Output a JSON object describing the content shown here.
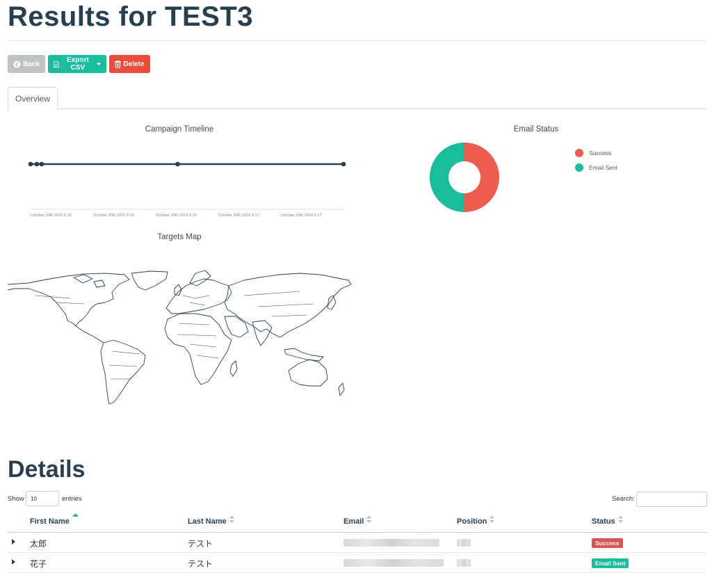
{
  "page": {
    "title": "Results for TEST3"
  },
  "toolbar": {
    "back_label": "Back",
    "export_label": "Export CSV",
    "delete_label": "Delete"
  },
  "tabs": [
    {
      "label": "Overview",
      "active": true
    }
  ],
  "timeline": {
    "title": "Campaign Timeline",
    "tick_labels": [
      "October 30th 2016 6:16",
      "October 30th 2016 6:16",
      "October 30th 2016 6:16",
      "October 30th 2016 6:17",
      "October 30th 2016 6:17"
    ]
  },
  "email_status": {
    "title": "Email Status",
    "legend": [
      {
        "label": "Success",
        "color": "#f05b4f"
      },
      {
        "label": "Email Sent",
        "color": "#1abc9c"
      }
    ]
  },
  "map": {
    "title": "Targets Map"
  },
  "details": {
    "title": "Details",
    "show_label": "Show",
    "length_value": "10",
    "entries_label": "entries",
    "search_label": "Search:",
    "columns": [
      "First Name",
      "Last Name",
      "Email",
      "Position",
      "Status"
    ],
    "rows": [
      {
        "first": "太郎",
        "last": "テスト",
        "status": "Success",
        "status_color": "#d9534f"
      },
      {
        "first": "花子",
        "last": "テスト",
        "status": "Email Sent",
        "status_color": "#1abc9c"
      }
    ]
  },
  "chart_data": [
    {
      "type": "scatter",
      "title": "Campaign Timeline",
      "x": [
        "October 30th 2016 6:16",
        "October 30th 2016 6:16",
        "October 30th 2016 6:16",
        "October 30th 2016 6:16",
        "October 30th 2016 6:17"
      ],
      "y": [
        1,
        1,
        1,
        1,
        1
      ]
    },
    {
      "type": "pie",
      "title": "Email Status",
      "categories": [
        "Success",
        "Email Sent"
      ],
      "values": [
        1,
        1
      ],
      "colors": [
        "#f05b4f",
        "#1abc9c"
      ]
    }
  ]
}
